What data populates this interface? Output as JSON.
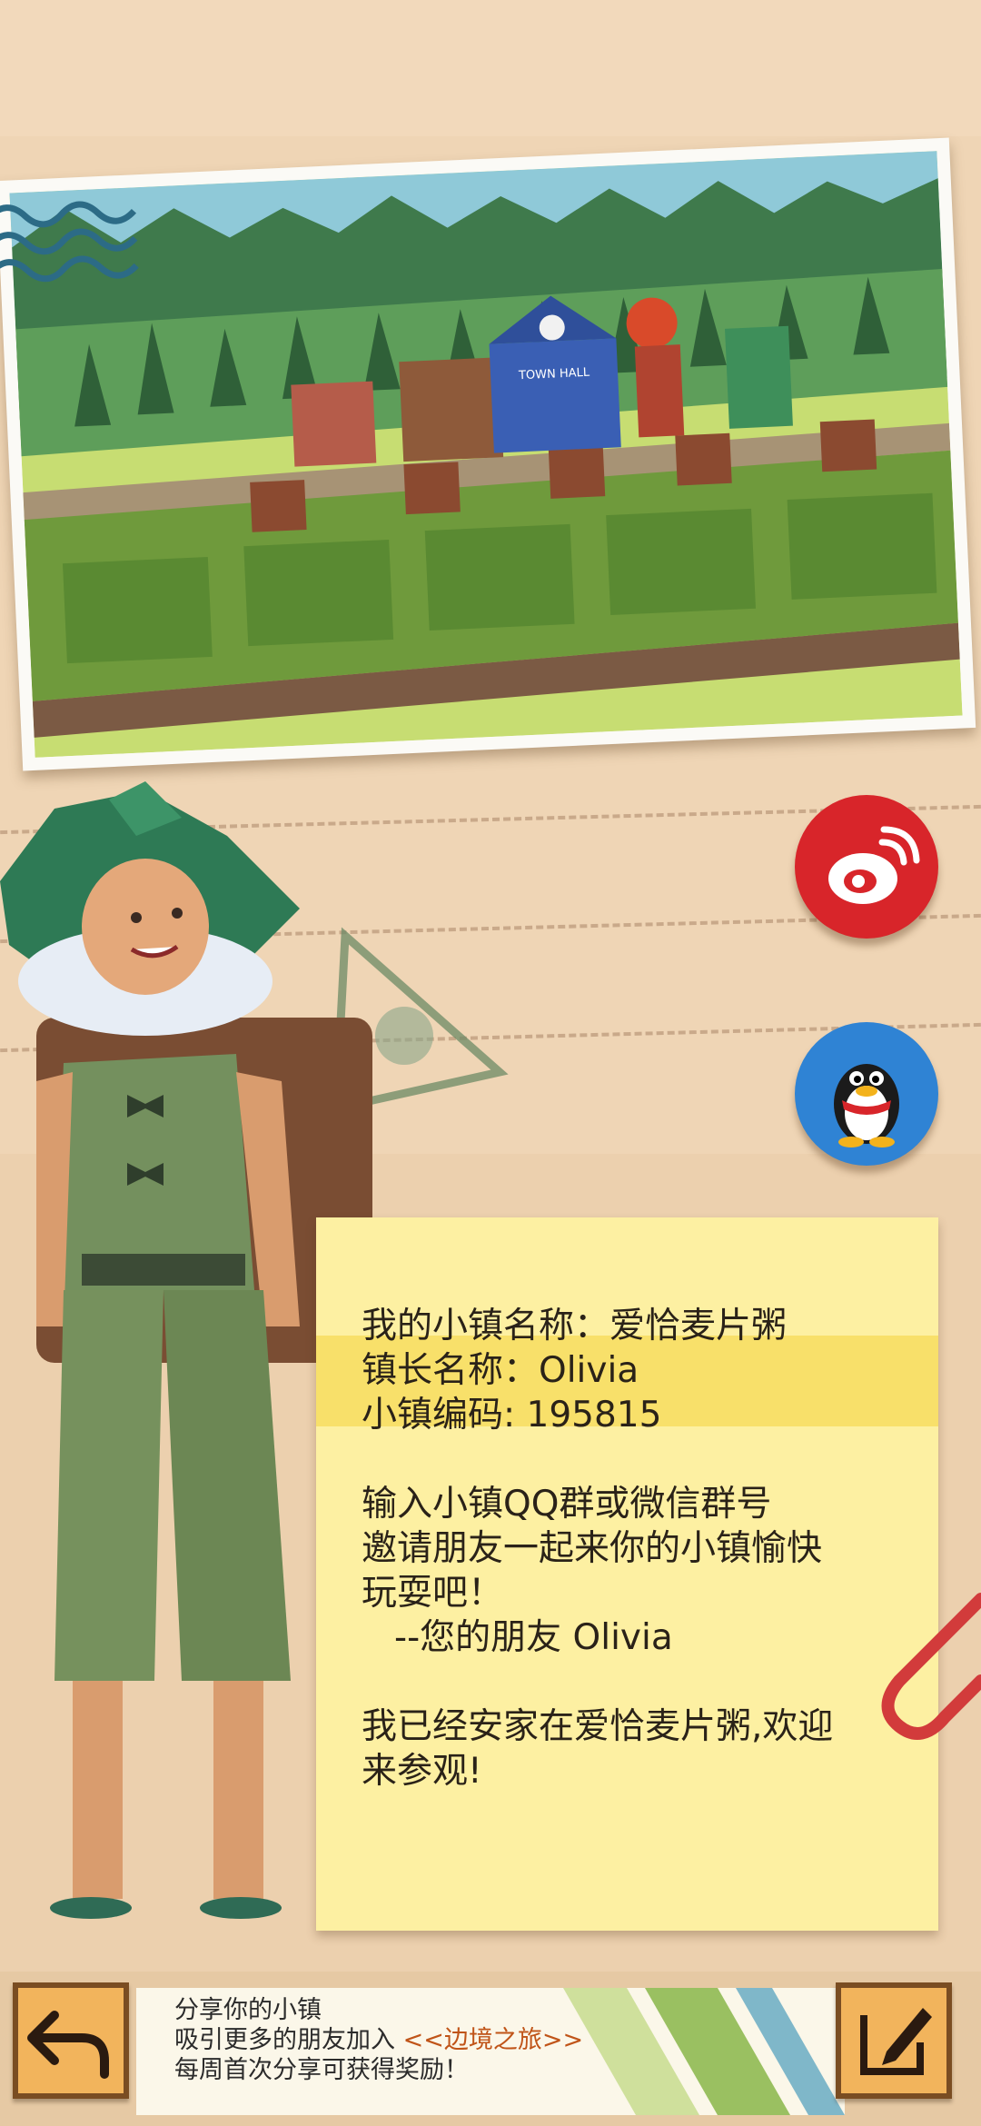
{
  "note": {
    "town_name_line": "我的小镇名称：爱恰麦片粥",
    "mayor_line": "镇长名称：Olivia",
    "code_line": "小镇编码: 195815",
    "invite_line1": "输入小镇QQ群或微信群号",
    "invite_line2": "邀请朋友一起来你的小镇愉快",
    "invite_line3": "玩耍吧！",
    "signature": "--您的朋友 Olivia",
    "welcome_line1": "我已经安家在爱恰麦片粥,欢迎",
    "welcome_line2": "来参观!"
  },
  "banner": {
    "line1": "分享你的小镇",
    "line2_prefix": "吸引更多的朋友加入 ",
    "line2_highlight": "<<边境之旅>>",
    "line3": "每周首次分享可获得奖励！"
  },
  "photo_signs": {
    "town_hall": "TOWN HALL"
  },
  "icons": {
    "share_weibo": "weibo-icon",
    "share_qq": "qq-penguin-icon",
    "back": "back-arrow-icon",
    "edit": "edit-pen-icon"
  },
  "colors": {
    "background": "#efd5b5",
    "note": "#fdf0a2",
    "weibo": "#d8252a",
    "qq": "#2f83d4",
    "highlight": "#c05418"
  }
}
